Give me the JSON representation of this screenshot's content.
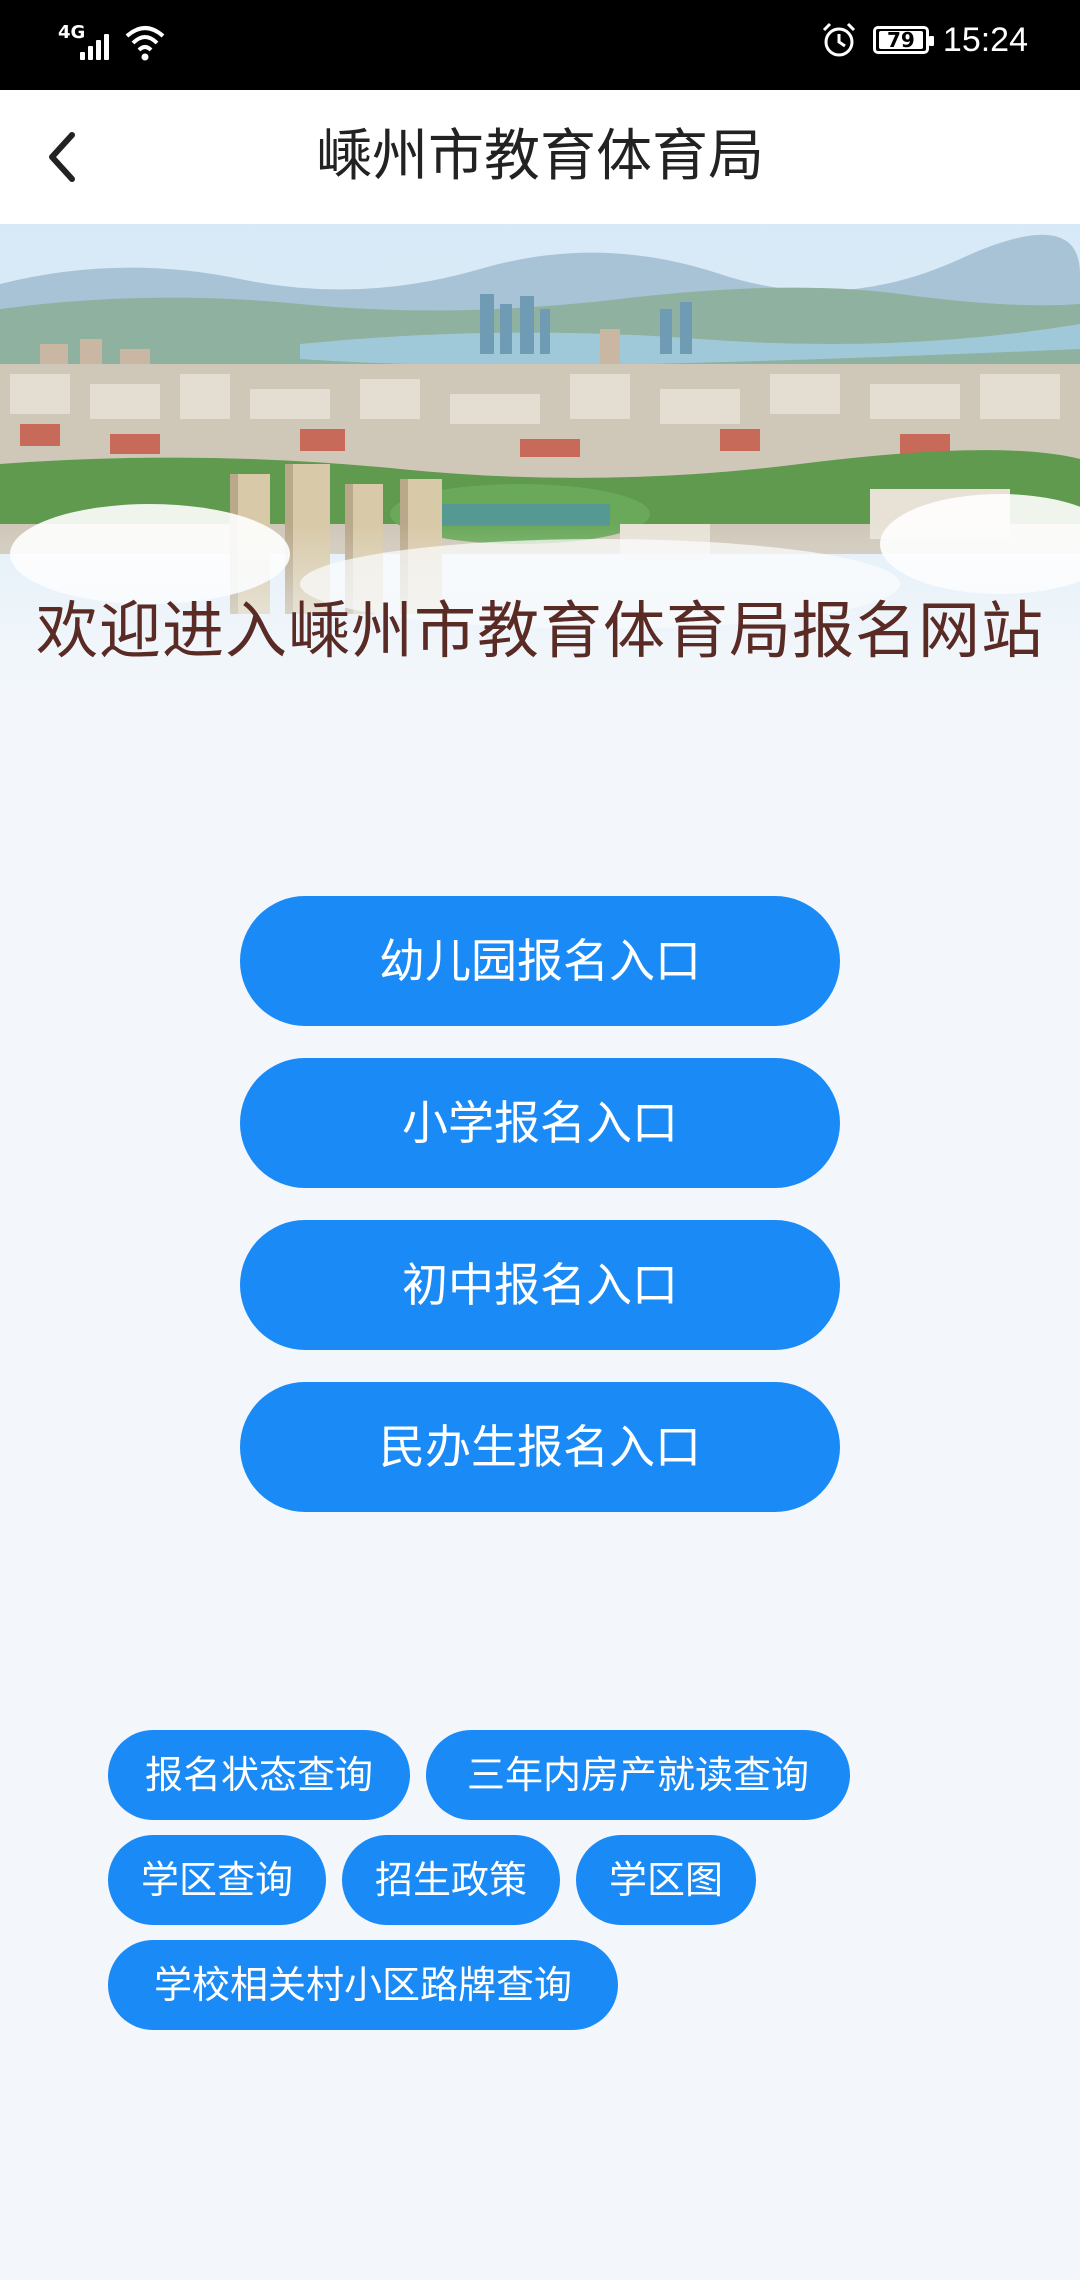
{
  "status_bar": {
    "network": "4G",
    "battery": "79",
    "time": "15:24"
  },
  "header": {
    "title": "嵊州市教育体育局"
  },
  "banner": {
    "welcome": "欢迎进入嵊州市教育体育局报名网站"
  },
  "entries": [
    {
      "label": "幼儿园报名入口"
    },
    {
      "label": "小学报名入口"
    },
    {
      "label": "初中报名入口"
    },
    {
      "label": "民办生报名入口"
    }
  ],
  "queries": [
    {
      "label": "报名状态查询"
    },
    {
      "label": "三年内房产就读查询"
    },
    {
      "label": "学区查询"
    },
    {
      "label": "招生政策"
    },
    {
      "label": "学区图"
    },
    {
      "label": "学校相关村小区路牌查询"
    }
  ],
  "colors": {
    "accent": "#1a8af6",
    "background": "#f3f7fb",
    "welcome_text": "#5a2a24"
  }
}
